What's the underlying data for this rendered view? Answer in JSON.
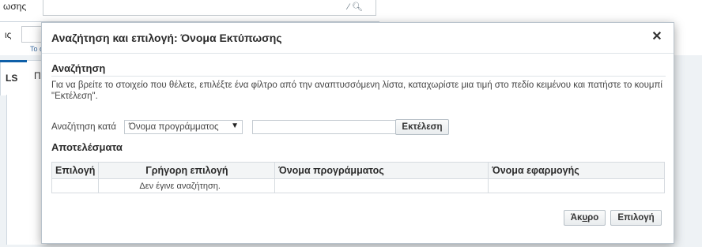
{
  "background": {
    "label_top": "ωσης",
    "label_mid": "ις",
    "hint_text": "Το όν",
    "tab_active": "LS",
    "tab_next": "Π"
  },
  "dialog": {
    "title": "Αναζήτηση και επιλογή: Όνομα Εκτύπωσης",
    "close_icon": "close-icon",
    "search_heading": "Αναζήτηση",
    "instructions": "Για να βρείτε το στοιχείο που θέλετε, επιλέξτε ένα φίλτρο από την αναπτυσσόμενη λίστα, καταχωρίστε μια τιμή στο πεδίο κειμένου και πατήστε το κουμπί \"Εκτέλεση\".",
    "search_by_label": "Αναζήτηση κατά",
    "search_by_selected": "Όνομα προγράμματος",
    "search_value": "",
    "execute_label": "Εκτέλεση",
    "results_heading": "Αποτελέσματα",
    "columns": [
      "Επιλογή",
      "Γρήγορη επιλογή",
      "Όνομα προγράμματος",
      "Όνομα εφαρμογής"
    ],
    "empty_message": "Δεν έγινε αναζήτηση.",
    "cancel_prefix": "Άκ",
    "cancel_mnemonic": "υ",
    "cancel_suffix": "ρο",
    "select_label": "Επιλογή"
  }
}
